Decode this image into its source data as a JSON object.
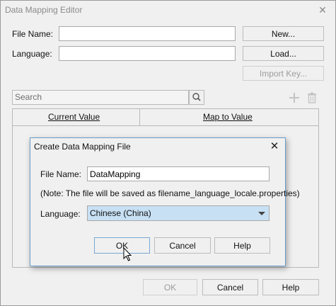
{
  "outer": {
    "title": "Data Mapping Editor",
    "file_name_label": "File Name:",
    "language_label": "Language:",
    "file_name_value": "",
    "language_value": "",
    "new_btn": "New...",
    "load_btn": "Load...",
    "import_key_btn": "Import Key...",
    "search_placeholder": "Search",
    "columns": [
      "Current Value",
      "Map to Value"
    ],
    "ok_btn": "OK",
    "cancel_btn": "Cancel",
    "help_btn": "Help"
  },
  "dialog": {
    "title": "Create Data Mapping File",
    "file_name_label": "File Name:",
    "file_name_value": "DataMapping",
    "note": "(Note: The file will be saved as filename_language_locale.properties)",
    "language_label": "Language:",
    "language_value": "Chinese (China)",
    "ok_btn": "OK",
    "cancel_btn": "Cancel",
    "help_btn": "Help"
  },
  "colors": {
    "dialog_border": "#6a9cc8",
    "select_highlight": "#c7e0f4"
  },
  "icons": [
    "close-icon",
    "search-icon",
    "add-icon",
    "delete-icon",
    "dropdown-arrow-icon",
    "mouse-cursor-icon"
  ]
}
